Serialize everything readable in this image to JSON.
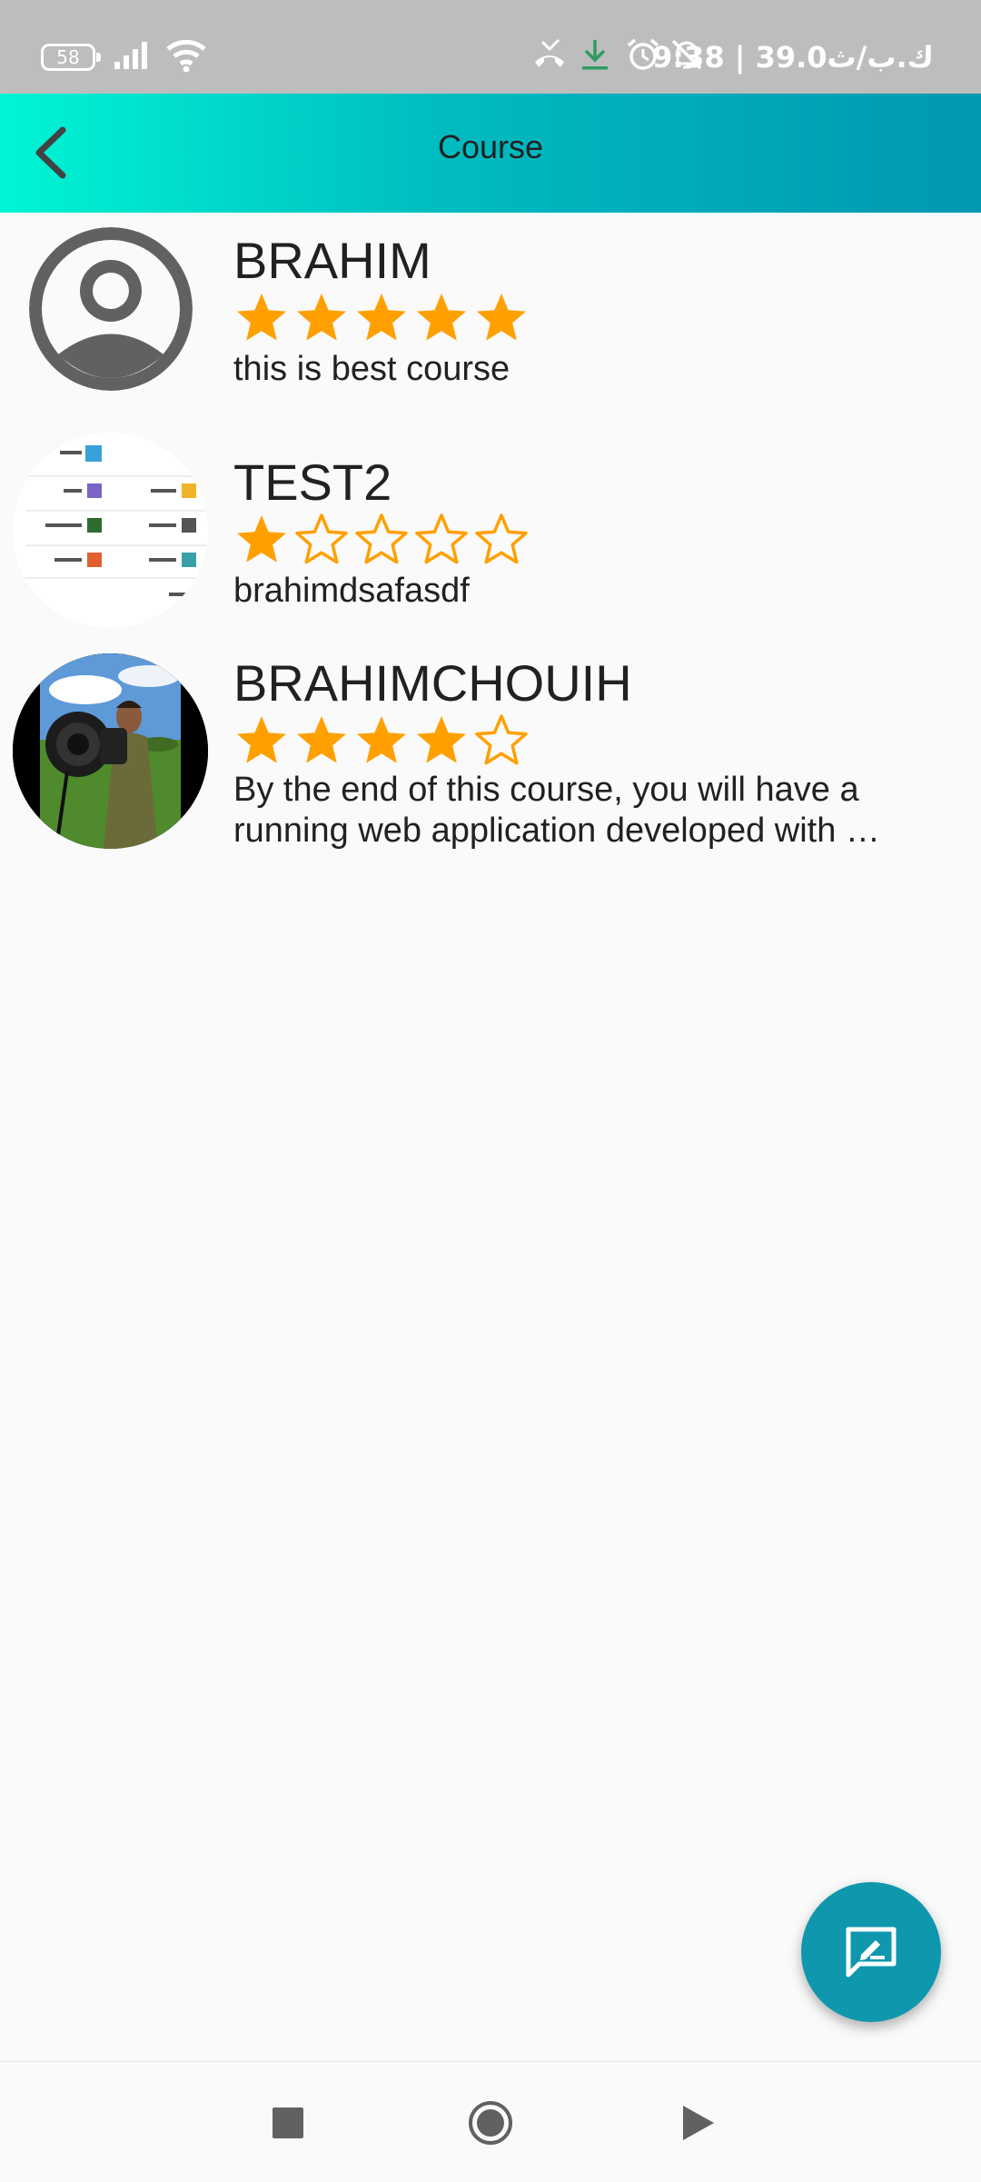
{
  "status_bar": {
    "battery": "58",
    "right_text": "ك.ب/ث39.0 | 9:38",
    "icons": [
      "signal-icon",
      "wifi-icon",
      "missed-call-icon",
      "download-icon",
      "alarm-icon",
      "notifications-off-icon"
    ]
  },
  "app_bar": {
    "title": "Course",
    "back_icon": "arrow-back-icon"
  },
  "reviews": [
    {
      "name": "BRAHIM",
      "rating": 5,
      "text": "this is best course",
      "avatar": "default-person-avatar"
    },
    {
      "name": "TEST2",
      "rating": 1,
      "text": "brahimdsafasdf",
      "avatar": "screenshot-thumbnail"
    },
    {
      "name": "BRAHIMCHOUIH",
      "rating": 4,
      "text": "By the end of this course, you will have a running web application developed with …",
      "avatar": "photo-man-with-camera"
    }
  ],
  "fab": {
    "icon": "rate-review-icon"
  },
  "nav": {
    "icons": [
      "recents-square-icon",
      "home-circle-icon",
      "back-triangle-icon"
    ]
  },
  "colors": {
    "star": "#ffa000",
    "app_bar_start": "#00f5d4",
    "app_bar_end": "#0097b2",
    "fab": "#0e97ad",
    "status_bar": "#bdbdbd"
  }
}
